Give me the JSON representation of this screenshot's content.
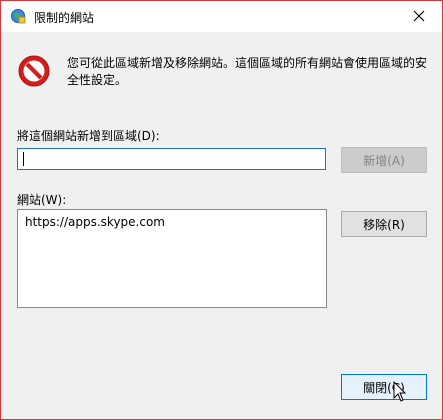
{
  "window": {
    "title": "限制的網站"
  },
  "description": "您可從此區域新增及移除網站。這個區域的所有網站會使用區域的安全性設定。",
  "add_section": {
    "label": "將這個網站新增到區域(D):",
    "input_value": "",
    "add_button": "新增(A)"
  },
  "sites_section": {
    "label": "網站(W):",
    "items": [
      "https://apps.skype.com"
    ],
    "remove_button": "移除(R)"
  },
  "footer": {
    "close_button": "關閉(C)"
  },
  "colors": {
    "window_border": "#d23a3a",
    "stop_red": "#d31e1e",
    "focus_blue": "#0078d7"
  }
}
